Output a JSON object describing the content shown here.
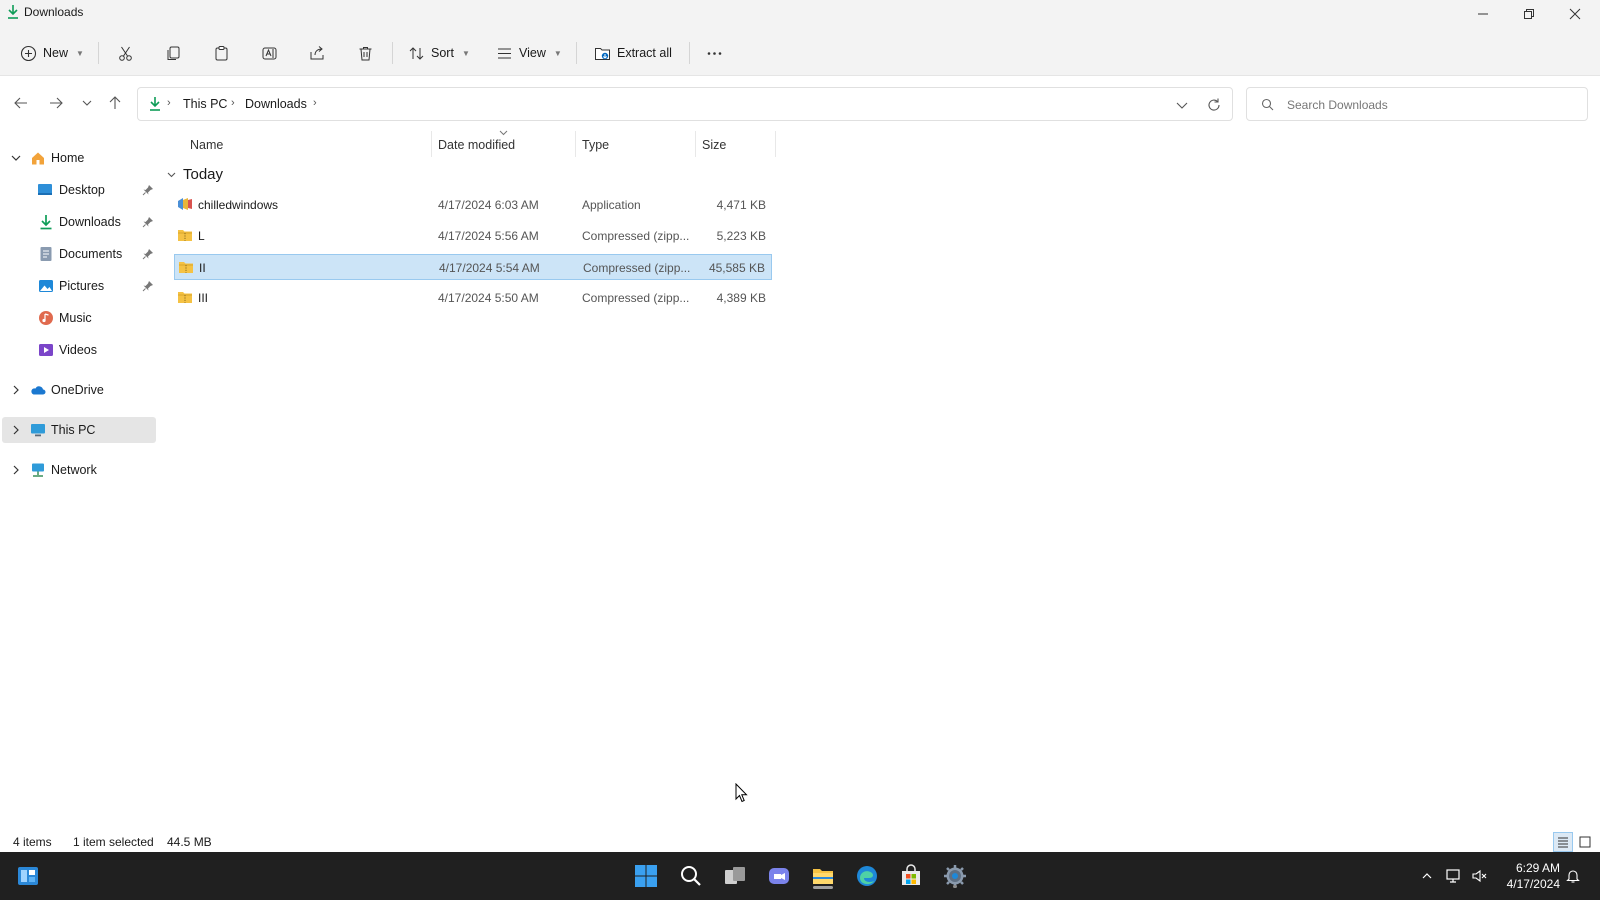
{
  "window": {
    "title": "Downloads",
    "controls": [
      "minimize-icon",
      "restore-icon",
      "close-icon"
    ]
  },
  "toolbar": {
    "new_label": "New",
    "sort_label": "Sort",
    "view_label": "View",
    "extract_label": "Extract all",
    "icons": [
      "new-icon",
      "cut-icon",
      "copy-icon",
      "paste-icon",
      "rename-icon",
      "share-icon",
      "delete-icon",
      "sort-icon",
      "view-icon",
      "extract-icon",
      "more-icon"
    ]
  },
  "address": {
    "crumbs": [
      "This PC",
      "Downloads"
    ]
  },
  "search": {
    "placeholder": "Search Downloads"
  },
  "sidebar": {
    "items": [
      {
        "label": "Home",
        "icon": "home-icon",
        "expanded": true
      },
      {
        "label": "Desktop",
        "icon": "desktop-icon",
        "pinned": true
      },
      {
        "label": "Downloads",
        "icon": "downloads-icon",
        "pinned": true
      },
      {
        "label": "Documents",
        "icon": "documents-icon",
        "pinned": true
      },
      {
        "label": "Pictures",
        "icon": "pictures-icon",
        "pinned": true
      },
      {
        "label": "Music",
        "icon": "music-icon"
      },
      {
        "label": "Videos",
        "icon": "videos-icon"
      },
      {
        "label": "OneDrive",
        "icon": "onedrive-icon",
        "expanded": false
      },
      {
        "label": "This PC",
        "icon": "this-pc-icon",
        "expanded": false,
        "selected": true
      },
      {
        "label": "Network",
        "icon": "network-icon",
        "expanded": false
      }
    ]
  },
  "columns": {
    "name": "Name",
    "date": "Date modified",
    "type": "Type",
    "size": "Size"
  },
  "group": {
    "label": "Today"
  },
  "files": [
    {
      "name": "chilledwindows",
      "date": "4/17/2024 6:03 AM",
      "type": "Application",
      "size": "4,471 KB",
      "icon": "application-icon",
      "selected": false
    },
    {
      "name": "L",
      "date": "4/17/2024 5:56 AM",
      "type": "Compressed (zipp...",
      "size": "5,223 KB",
      "icon": "zip-folder-icon",
      "selected": false
    },
    {
      "name": "II",
      "date": "4/17/2024 5:54 AM",
      "type": "Compressed (zipp...",
      "size": "45,585 KB",
      "icon": "zip-folder-icon",
      "selected": true
    },
    {
      "name": "III",
      "date": "4/17/2024 5:50 AM",
      "type": "Compressed (zipp...",
      "size": "4,389 KB",
      "icon": "zip-folder-icon",
      "selected": false
    }
  ],
  "status": {
    "count": "4 items",
    "selected": "1 item selected",
    "size": "44.5 MB"
  },
  "taskbar": {
    "apps": [
      "start-icon",
      "search-icon",
      "task-view-icon",
      "chat-icon",
      "file-explorer-icon",
      "edge-icon",
      "store-icon",
      "settings-icon"
    ],
    "active_app": "file-explorer-icon",
    "time": "6:29 AM",
    "date": "4/17/2024"
  },
  "colors": {
    "accent": "#0067c0",
    "selection": "#cce4f7",
    "taskbar": "#202020",
    "folder": "#f5c244"
  }
}
